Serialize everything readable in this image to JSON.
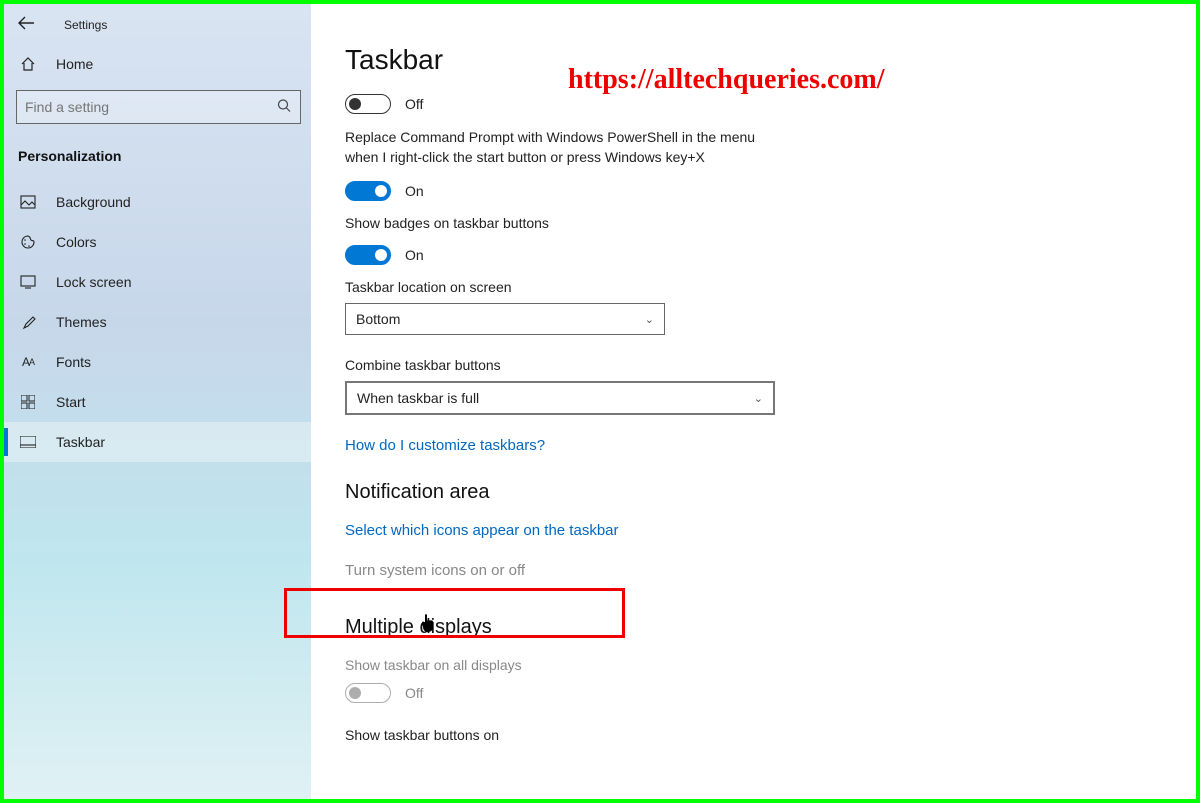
{
  "header": {
    "title": "Settings"
  },
  "search": {
    "placeholder": "Find a setting"
  },
  "section_label": "Personalization",
  "nav": {
    "home": "Home",
    "items": [
      {
        "label": "Background"
      },
      {
        "label": "Colors"
      },
      {
        "label": "Lock screen"
      },
      {
        "label": "Themes"
      },
      {
        "label": "Fonts"
      },
      {
        "label": "Start"
      },
      {
        "label": "Taskbar"
      }
    ]
  },
  "main": {
    "title": "Taskbar",
    "toggle1": {
      "state": "Off"
    },
    "powershell_desc": "Replace Command Prompt with Windows PowerShell in the menu when I right-click the start button or press Windows key+X",
    "toggle2": {
      "state": "On"
    },
    "badges_label": "Show badges on taskbar buttons",
    "toggle3": {
      "state": "On"
    },
    "location_label": "Taskbar location on screen",
    "location_value": "Bottom",
    "combine_label": "Combine taskbar buttons",
    "combine_value": "When taskbar is full",
    "help_link": "How do I customize taskbars?",
    "notif_heading": "Notification area",
    "select_icons_link": "Select which icons appear on the taskbar",
    "turn_icons_link": "Turn system icons on or off",
    "multi_heading": "Multiple displays",
    "show_all_label": "Show taskbar on all displays",
    "toggle4": {
      "state": "Off"
    },
    "show_buttons_label": "Show taskbar buttons on"
  },
  "watermark": "https://alltechqueries.com/"
}
